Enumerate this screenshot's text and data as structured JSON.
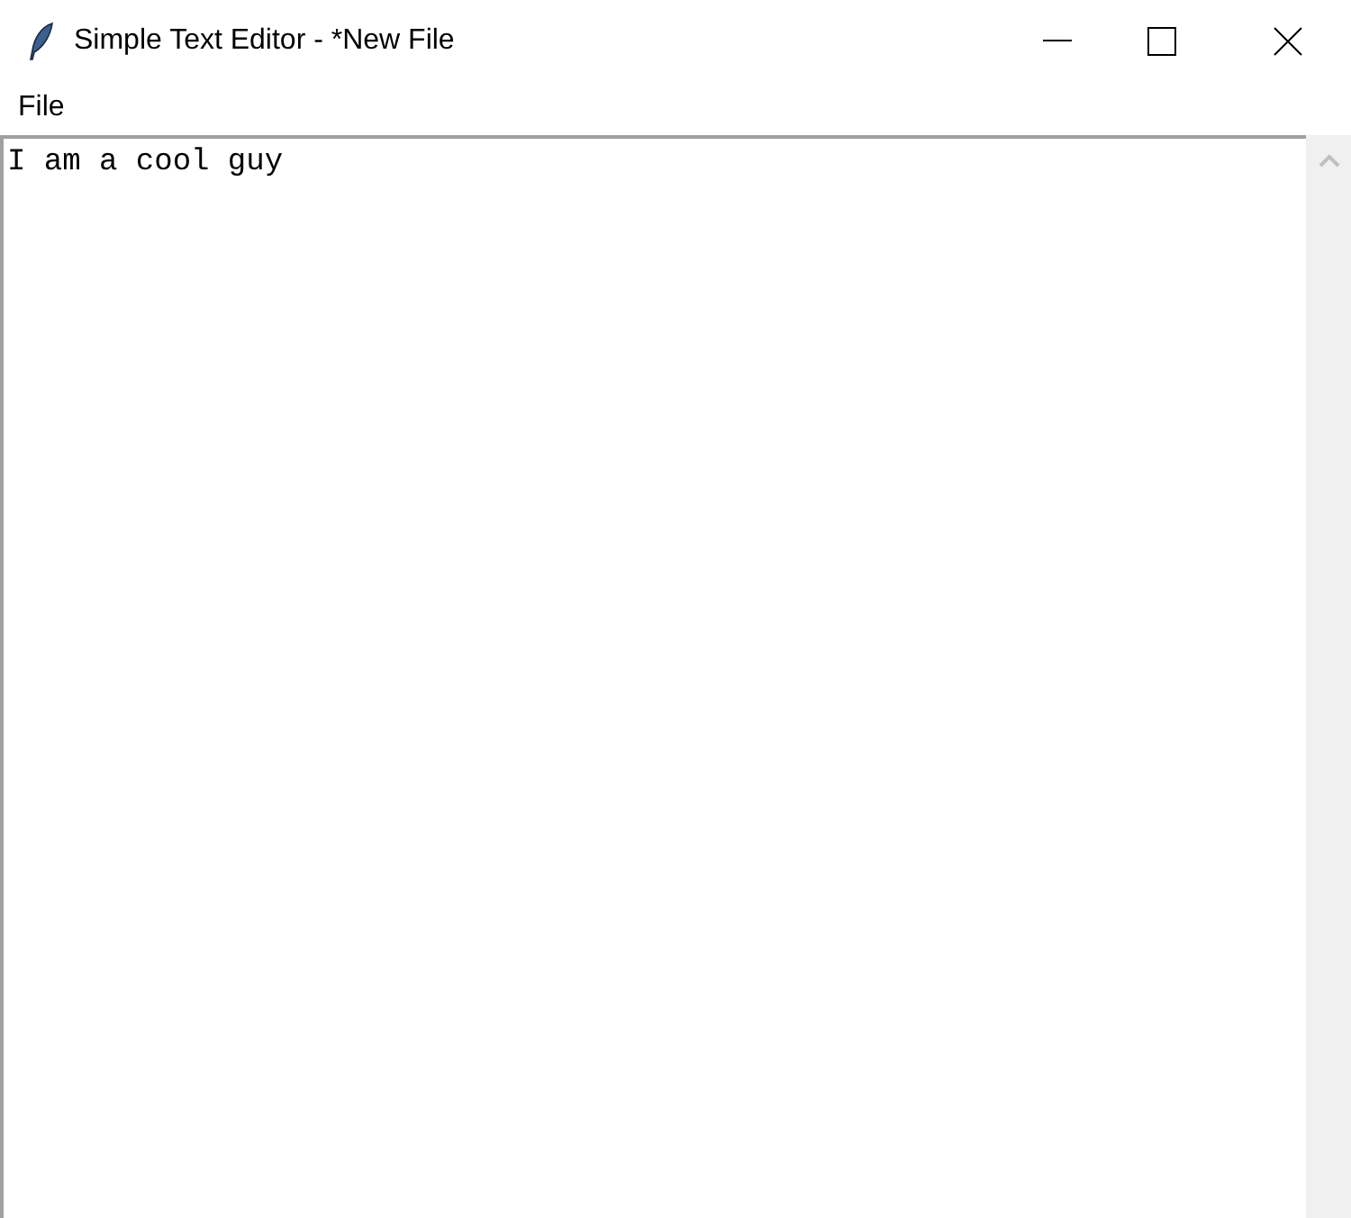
{
  "window": {
    "title": "Simple Text Editor - *New File"
  },
  "menu": [
    "File"
  ],
  "editor": {
    "value": "I am a cool guy"
  }
}
